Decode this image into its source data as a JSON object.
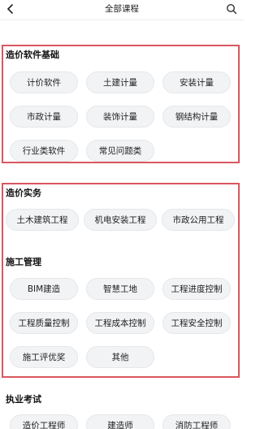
{
  "header": {
    "title": "全部课程",
    "back_icon": "chevron-left-icon",
    "search_icon": "search-icon"
  },
  "highlight_color": "#d9575f",
  "sections": [
    {
      "title": "造价软件基础",
      "items": [
        "计价软件",
        "土建计量",
        "安装计量",
        "市政计量",
        "装饰计量",
        "钢结构计量",
        "行业类软件",
        "常见问题类"
      ]
    },
    {
      "title": "造价实务",
      "items": [
        "土木建筑工程",
        "机电安装工程",
        "市政公用工程"
      ]
    },
    {
      "title": "施工管理",
      "items": [
        "BIM建造",
        "智慧工地",
        "工程进度控制",
        "工程质量控制",
        "工程成本控制",
        "工程安全控制",
        "施工评优奖",
        "其他"
      ]
    },
    {
      "title": "执业考试",
      "items": [
        "造价工程师",
        "建造师",
        "消防工程师"
      ]
    }
  ]
}
